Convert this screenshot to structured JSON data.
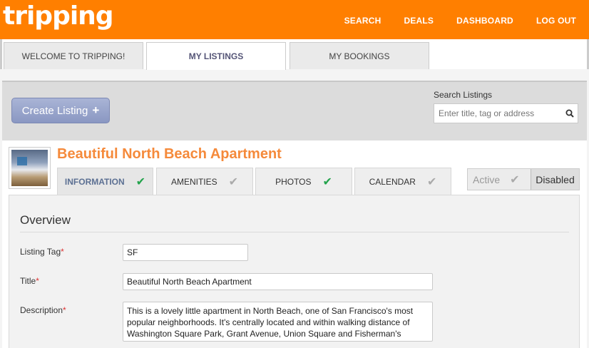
{
  "header": {
    "logo": "tripping",
    "nav": [
      "SEARCH",
      "DEALS",
      "DASHBOARD",
      "LOG OUT"
    ]
  },
  "main_tabs": [
    {
      "label": "WELCOME TO TRIPPING!",
      "active": false
    },
    {
      "label": "MY LISTINGS",
      "active": true
    },
    {
      "label": "MY BOOKINGS",
      "active": false
    }
  ],
  "toolbar": {
    "create_label": "Create Listing",
    "search_label": "Search Listings",
    "search_placeholder": "Enter title, tag or address"
  },
  "listing": {
    "title": "Beautiful North Beach Apartment",
    "tabs": [
      {
        "label": "INFORMATION",
        "complete": true,
        "active": true
      },
      {
        "label": "AMENITIES",
        "complete": false,
        "active": false
      },
      {
        "label": "PHOTOS",
        "complete": true,
        "active": false
      },
      {
        "label": "CALENDAR",
        "complete": false,
        "active": false
      }
    ],
    "status_active": "Active",
    "status_disabled": "Disabled"
  },
  "form": {
    "section_title": "Overview",
    "tag_label": "Listing Tag",
    "tag_value": "SF",
    "title_label": "Title",
    "title_value": "Beautiful North Beach Apartment",
    "description_label": "Description",
    "description_value": "This is a lovely little apartment in North Beach, one of San Francisco's most popular neighborhoods. It's centrally located and within walking distance of Washington Square Park, Grant Avenue, Union Square and Fisherman's Wharf.",
    "required_mark": "*"
  },
  "colors": {
    "brand_orange": "#ff7f00",
    "title_orange": "#f58a3b",
    "check_green": "#23a34c",
    "button_blue": "#8a97c2"
  }
}
